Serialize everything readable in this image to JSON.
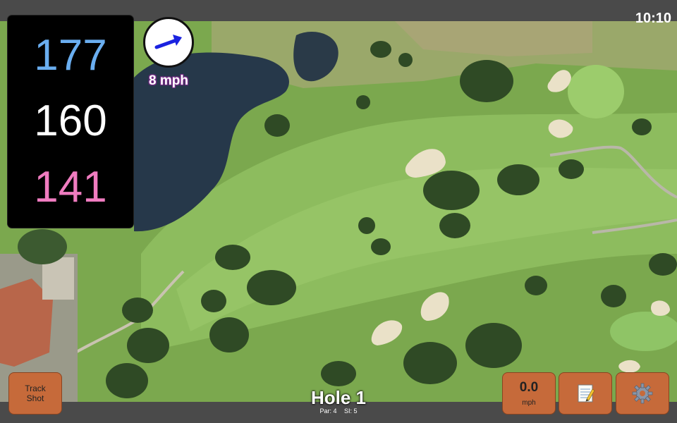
{
  "status": {
    "time": "10:10"
  },
  "distances": {
    "back": "177",
    "middle": "160",
    "front": "141"
  },
  "wind": {
    "speed": "8 mph",
    "direction_icon": "arrow-right-up-icon"
  },
  "hole": {
    "title": "Hole 1",
    "par": "Par: 4",
    "si": "SI: 5"
  },
  "buttons": {
    "track_line1": "Track",
    "track_line2": "Shot",
    "wind_value": "0.0",
    "wind_unit": "mph",
    "notes_icon": "notepad-icon",
    "settings_icon": "gear-icon"
  },
  "colors": {
    "back": "#6aaef0",
    "front": "#f07cc0",
    "button": "#c66a3a",
    "fairway": "#86b25a"
  }
}
